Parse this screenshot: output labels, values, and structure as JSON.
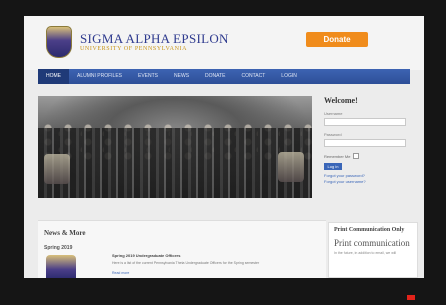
{
  "brand": {
    "title": "SIGMA ALPHA EPSILON",
    "subtitle": "UNIVERSITY OF PENNSYLVANIA",
    "logo_icon": "crest-icon"
  },
  "donate_label": "Donate",
  "nav": {
    "items": [
      {
        "label": "HOME",
        "active": true
      },
      {
        "label": "ALUMNI PROFILES",
        "active": false
      },
      {
        "label": "EVENTS",
        "active": false
      },
      {
        "label": "NEWS",
        "active": false
      },
      {
        "label": "DONATE",
        "active": false
      },
      {
        "label": "CONTACT",
        "active": false
      },
      {
        "label": "LOGIN",
        "active": false
      }
    ]
  },
  "sidebar": {
    "welcome": "Welcome!",
    "username_label": "Username",
    "password_label": "Password",
    "remember_label": "Remember Me",
    "login_label": "Log in",
    "forgot_password": "Forgot your password?",
    "forgot_username": "Forgot your username?"
  },
  "news": {
    "title": "News & More",
    "section": "Spring 2019",
    "item_heading": "Spring 2019 Undergraduate Officers",
    "item_text": "Here is a list of the current Pennsylvania Theta Undergraduate Officers for the Spring semester",
    "read_more": "Read more"
  },
  "print": {
    "title": "Print Communication Only",
    "subtitle": "Print communication",
    "text": "In the future, in addition to email, we will"
  },
  "colors": {
    "accent": "#2d4f98",
    "donate": "#f08c1c",
    "brand_blue": "#2e3a8e",
    "brand_gold": "#c8961a"
  }
}
